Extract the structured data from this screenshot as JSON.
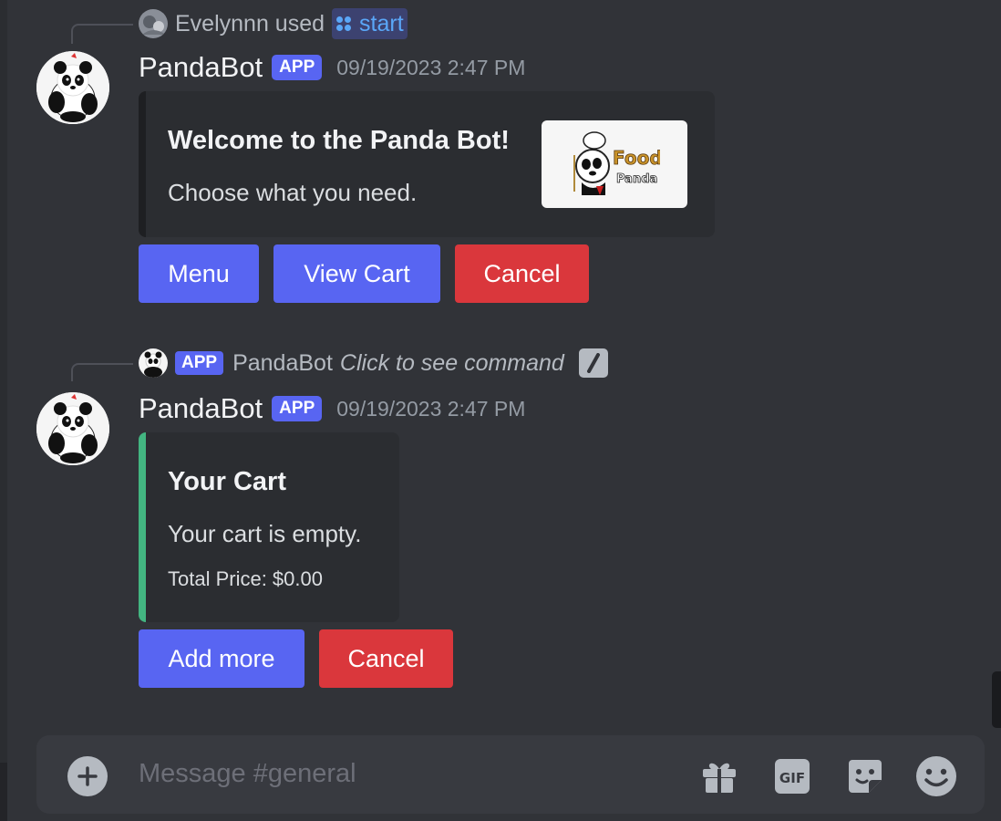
{
  "messages": [
    {
      "reply": {
        "user": "Evelynnn used",
        "command": "start"
      },
      "author": "PandaBot",
      "badge": "APP",
      "timestamp": "09/19/2023 2:47 PM",
      "embed": {
        "title": "Welcome to the Panda Bot!",
        "description": "Choose what you need.",
        "thumbnail_text_1": "Food",
        "thumbnail_text_2": "Panda",
        "accent_color": "#1e1f22"
      },
      "buttons": [
        {
          "label": "Menu",
          "style": "primary"
        },
        {
          "label": "View Cart",
          "style": "primary"
        },
        {
          "label": "Cancel",
          "style": "danger"
        }
      ]
    },
    {
      "reply": {
        "badge": "APP",
        "user": "PandaBot",
        "command_link": "Click to see command"
      },
      "author": "PandaBot",
      "badge": "APP",
      "timestamp": "09/19/2023 2:47 PM",
      "embed": {
        "title": "Your Cart",
        "description": "Your cart is empty.",
        "total": "Total Price: $0.00",
        "accent_color": "#43b581"
      },
      "buttons": [
        {
          "label": "Add more",
          "style": "primary"
        },
        {
          "label": "Cancel",
          "style": "danger"
        }
      ]
    }
  ],
  "composer": {
    "placeholder": "Message #general",
    "tools": [
      "gift-icon",
      "gif-icon",
      "sticker-icon",
      "emoji-icon"
    ],
    "gif_label": "GIF"
  },
  "colors": {
    "background": "#313338",
    "primary": "#5865f2",
    "danger": "#da373c",
    "cart_accent": "#43b581"
  }
}
